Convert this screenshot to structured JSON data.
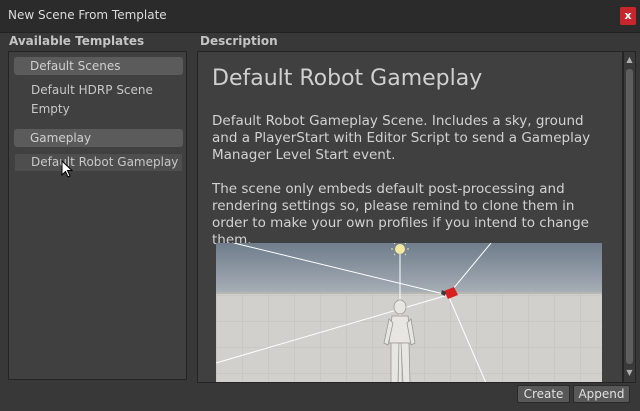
{
  "window": {
    "title": "New Scene From Template",
    "close_label": "x"
  },
  "templates": {
    "header": "Available Templates",
    "groups": [
      {
        "label": "Default Scenes",
        "items": [
          "Default HDRP Scene",
          "Empty"
        ]
      },
      {
        "label": "Gameplay",
        "items": [
          "Default Robot Gameplay"
        ]
      }
    ]
  },
  "description": {
    "header": "Description",
    "title": "Default Robot Gameplay",
    "paragraphs": [
      "Default Robot Gameplay Scene. Includes a sky, ground and a PlayerStart with Editor Script to send a Gameplay Manager Level Start event.",
      "The scene only embeds default post-processing and rendering settings so, please remind to clone them in order to make your own profiles if you intend to change them."
    ]
  },
  "buttons": {
    "create": "Create",
    "append": "Append"
  },
  "colors": {
    "accent_close": "#c8262c",
    "background": "#383838",
    "panel": "#404040"
  }
}
